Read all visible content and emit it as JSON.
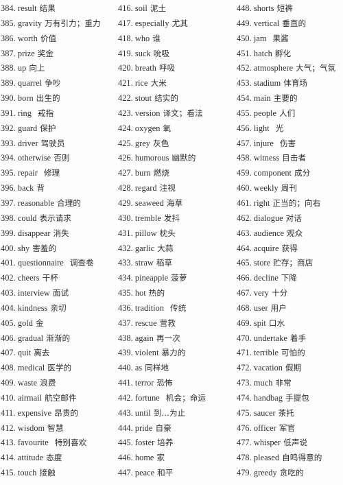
{
  "document": {
    "type": "vocabulary-list",
    "language_pair": "English-Chinese",
    "number_range": "384-479",
    "total_entries": 96,
    "columns": 3,
    "rows_per_column": 32
  },
  "columns": [
    {
      "id": "column-1",
      "entries": [
        {
          "num": "384.",
          "word": "result",
          "gloss": "结果",
          "wide_gap": false
        },
        {
          "num": "385.",
          "word": "gravity",
          "gloss": "万有引力；重力",
          "wide_gap": false
        },
        {
          "num": "386.",
          "word": "worth",
          "gloss": "价值",
          "wide_gap": false
        },
        {
          "num": "387.",
          "word": "prize",
          "gloss": "奖金",
          "wide_gap": false
        },
        {
          "num": "388.",
          "word": "up",
          "gloss": "向上",
          "wide_gap": false
        },
        {
          "num": "389.",
          "word": "quarrel",
          "gloss": "争吵",
          "wide_gap": false
        },
        {
          "num": "390.",
          "word": "born",
          "gloss": "出生的",
          "wide_gap": false
        },
        {
          "num": "391.",
          "word": "ring",
          "gloss": "戒指",
          "wide_gap": true
        },
        {
          "num": "392.",
          "word": "guard",
          "gloss": "保护",
          "wide_gap": false
        },
        {
          "num": "393.",
          "word": "driver",
          "gloss": "驾驶员",
          "wide_gap": false
        },
        {
          "num": "394.",
          "word": "otherwise",
          "gloss": "否则",
          "wide_gap": false
        },
        {
          "num": "395.",
          "word": "repair",
          "gloss": "修理",
          "wide_gap": true
        },
        {
          "num": "396.",
          "word": "back",
          "gloss": "背",
          "wide_gap": false
        },
        {
          "num": "397.",
          "word": "reasonable",
          "gloss": "合理的",
          "wide_gap": false
        },
        {
          "num": "398.",
          "word": "could",
          "gloss": "表示请求",
          "wide_gap": false
        },
        {
          "num": "399.",
          "word": "disappear",
          "gloss": "消失",
          "wide_gap": false
        },
        {
          "num": "400.",
          "word": "shy",
          "gloss": "害羞的",
          "wide_gap": false
        },
        {
          "num": "401.",
          "word": "questionnaire",
          "gloss": "调查卷",
          "wide_gap": true
        },
        {
          "num": "402.",
          "word": "cheers",
          "gloss": "干杯",
          "wide_gap": false
        },
        {
          "num": "403.",
          "word": "interview",
          "gloss": "面试",
          "wide_gap": false
        },
        {
          "num": "404.",
          "word": "kindness",
          "gloss": "亲切",
          "wide_gap": false
        },
        {
          "num": "405.",
          "word": "gold",
          "gloss": "金",
          "wide_gap": false
        },
        {
          "num": "406.",
          "word": "gradual",
          "gloss": "渐渐的",
          "wide_gap": false
        },
        {
          "num": "407.",
          "word": "quit",
          "gloss": "离去",
          "wide_gap": false
        },
        {
          "num": "408.",
          "word": "medical",
          "gloss": "医学的",
          "wide_gap": false
        },
        {
          "num": "409.",
          "word": "waste",
          "gloss": "浪费",
          "wide_gap": false
        },
        {
          "num": "410.",
          "word": "airmail",
          "gloss": "航空邮件",
          "wide_gap": false
        },
        {
          "num": "411.",
          "word": "expensive",
          "gloss": "昂贵的",
          "wide_gap": false
        },
        {
          "num": "412.",
          "word": "wisdom",
          "gloss": "智慧",
          "wide_gap": false
        },
        {
          "num": "413.",
          "word": "favourite",
          "gloss": "特别喜欢",
          "wide_gap": true
        },
        {
          "num": "414.",
          "word": "attitude",
          "gloss": "态度",
          "wide_gap": false
        },
        {
          "num": "415.",
          "word": "touch",
          "gloss": "接触",
          "wide_gap": false
        }
      ]
    },
    {
      "id": "column-2",
      "entries": [
        {
          "num": "416.",
          "word": "soil",
          "gloss": "泥土",
          "wide_gap": false
        },
        {
          "num": "417.",
          "word": "especially",
          "gloss": "尤其",
          "wide_gap": false
        },
        {
          "num": "418.",
          "word": "who",
          "gloss": "谁",
          "wide_gap": false
        },
        {
          "num": "419.",
          "word": "suck",
          "gloss": "吮吸",
          "wide_gap": false
        },
        {
          "num": "420.",
          "word": "breath",
          "gloss": "呼吸",
          "wide_gap": false
        },
        {
          "num": "421.",
          "word": "rice",
          "gloss": "大米",
          "wide_gap": false
        },
        {
          "num": "422.",
          "word": "stout",
          "gloss": "结实的",
          "wide_gap": false
        },
        {
          "num": "423.",
          "word": "version",
          "gloss": "译文；看法",
          "wide_gap": false
        },
        {
          "num": "424.",
          "word": "oxygen",
          "gloss": "氧",
          "wide_gap": false
        },
        {
          "num": "425.",
          "word": "grey",
          "gloss": "灰色",
          "wide_gap": false
        },
        {
          "num": "426.",
          "word": "humorous",
          "gloss": "幽默的",
          "wide_gap": false
        },
        {
          "num": "427.",
          "word": "burn",
          "gloss": "燃烧",
          "wide_gap": false
        },
        {
          "num": "428.",
          "word": "regard",
          "gloss": "注视",
          "wide_gap": false
        },
        {
          "num": "429.",
          "word": "seaweed",
          "gloss": "海草",
          "wide_gap": false
        },
        {
          "num": "430.",
          "word": "tremble",
          "gloss": "发抖",
          "wide_gap": false
        },
        {
          "num": "431.",
          "word": "pillow",
          "gloss": "枕头",
          "wide_gap": false
        },
        {
          "num": "432.",
          "word": "garlic",
          "gloss": "大蒜",
          "wide_gap": false
        },
        {
          "num": "433.",
          "word": "straw",
          "gloss": "稻草",
          "wide_gap": false
        },
        {
          "num": "434.",
          "word": "pineapple",
          "gloss": "菠萝",
          "wide_gap": false
        },
        {
          "num": "435.",
          "word": "hot",
          "gloss": "热的",
          "wide_gap": false
        },
        {
          "num": "436.",
          "word": "tradition",
          "gloss": "传统",
          "wide_gap": true
        },
        {
          "num": "437.",
          "word": "rescue",
          "gloss": "营救",
          "wide_gap": false
        },
        {
          "num": "438.",
          "word": "again",
          "gloss": "再一次",
          "wide_gap": false
        },
        {
          "num": "439.",
          "word": "violent",
          "gloss": "暴力的",
          "wide_gap": false
        },
        {
          "num": "440.",
          "word": "as",
          "gloss": "同样地",
          "wide_gap": false
        },
        {
          "num": "441.",
          "word": "terror",
          "gloss": "恐怖",
          "wide_gap": false
        },
        {
          "num": "442.",
          "word": "fortune",
          "gloss": "机会；命运",
          "wide_gap": true
        },
        {
          "num": "443.",
          "word": "until",
          "gloss": "到…为止",
          "wide_gap": false
        },
        {
          "num": "444.",
          "word": "pride",
          "gloss": "自豪",
          "wide_gap": false
        },
        {
          "num": "445.",
          "word": "foster",
          "gloss": "培养",
          "wide_gap": false
        },
        {
          "num": "446.",
          "word": "home",
          "gloss": "家",
          "wide_gap": false
        },
        {
          "num": "447.",
          "word": "peace",
          "gloss": "和平",
          "wide_gap": false
        }
      ]
    },
    {
      "id": "column-3",
      "entries": [
        {
          "num": "448.",
          "word": "shorts",
          "gloss": "短裤",
          "wide_gap": false
        },
        {
          "num": "449.",
          "word": "vertical",
          "gloss": "垂直的",
          "wide_gap": false
        },
        {
          "num": "450.",
          "word": "jam",
          "gloss": "果酱",
          "wide_gap": true
        },
        {
          "num": "451.",
          "word": "hatch",
          "gloss": "孵化",
          "wide_gap": false
        },
        {
          "num": "452.",
          "word": "atmosphere",
          "gloss": "大气；气氛",
          "wide_gap": false
        },
        {
          "num": "453.",
          "word": "stadium",
          "gloss": "体育场",
          "wide_gap": false
        },
        {
          "num": "454.",
          "word": "main",
          "gloss": "主要的",
          "wide_gap": false
        },
        {
          "num": "455.",
          "word": "people",
          "gloss": "人们",
          "wide_gap": false
        },
        {
          "num": "456.",
          "word": "light",
          "gloss": "光",
          "wide_gap": true
        },
        {
          "num": "457.",
          "word": "injure",
          "gloss": "伤害",
          "wide_gap": true
        },
        {
          "num": "458.",
          "word": "witness",
          "gloss": "目击者",
          "wide_gap": false
        },
        {
          "num": "459.",
          "word": "component",
          "gloss": "成分",
          "wide_gap": false
        },
        {
          "num": "460.",
          "word": "weekly",
          "gloss": "周刊",
          "wide_gap": false
        },
        {
          "num": "461.",
          "word": "right",
          "gloss": "正当的；向右",
          "wide_gap": false
        },
        {
          "num": "462.",
          "word": "dialogue",
          "gloss": "对话",
          "wide_gap": false
        },
        {
          "num": "463.",
          "word": "audience",
          "gloss": "观众",
          "wide_gap": false
        },
        {
          "num": "464.",
          "word": "acquire",
          "gloss": "获得",
          "wide_gap": false
        },
        {
          "num": "465.",
          "word": "store",
          "gloss": "贮存；商店",
          "wide_gap": false
        },
        {
          "num": "466.",
          "word": "decline",
          "gloss": "下降",
          "wide_gap": false
        },
        {
          "num": "467.",
          "word": "very",
          "gloss": "十分",
          "wide_gap": false
        },
        {
          "num": "468.",
          "word": "user",
          "gloss": "用户",
          "wide_gap": false
        },
        {
          "num": "469.",
          "word": "spit",
          "gloss": "口水",
          "wide_gap": false
        },
        {
          "num": "470.",
          "word": "undertake",
          "gloss": "着手",
          "wide_gap": false
        },
        {
          "num": "471.",
          "word": "terrible",
          "gloss": "可怕的",
          "wide_gap": false
        },
        {
          "num": "472.",
          "word": "vacation",
          "gloss": "假期",
          "wide_gap": false
        },
        {
          "num": "473.",
          "word": "much",
          "gloss": "非常",
          "wide_gap": false
        },
        {
          "num": "474.",
          "word": "handbag",
          "gloss": "手提包",
          "wide_gap": false
        },
        {
          "num": "475.",
          "word": "saucer",
          "gloss": "茶托",
          "wide_gap": false
        },
        {
          "num": "476.",
          "word": "officer",
          "gloss": "军官",
          "wide_gap": false
        },
        {
          "num": "477.",
          "word": "whisper",
          "gloss": "低声说",
          "wide_gap": false
        },
        {
          "num": "478.",
          "word": "pleased",
          "gloss": "自鸣得意的",
          "wide_gap": false
        },
        {
          "num": "479.",
          "word": "greedy",
          "gloss": "贪吃的",
          "wide_gap": false
        }
      ]
    }
  ]
}
